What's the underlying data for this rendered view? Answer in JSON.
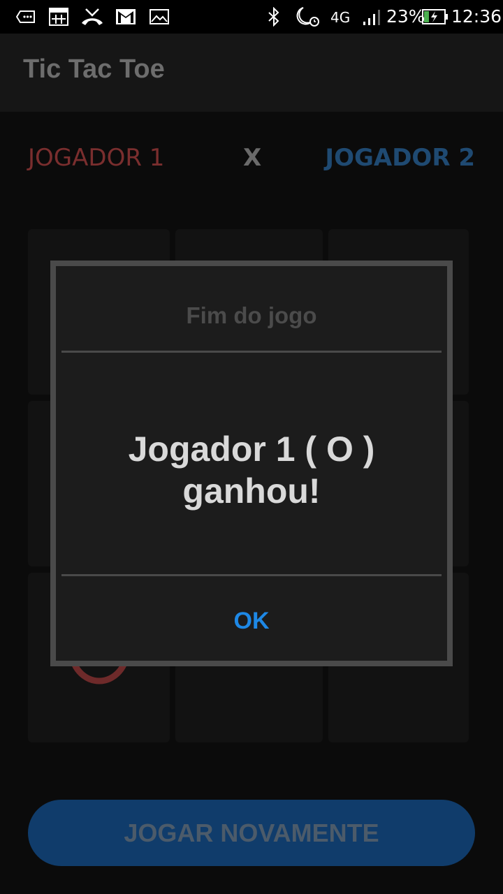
{
  "status_bar": {
    "network": "4G",
    "battery_percent": "23%",
    "time": "12:36",
    "icons": [
      "voicemail-icon",
      "calendar-icon",
      "missed-call-icon",
      "gmail-icon",
      "image-icon",
      "bluetooth-icon",
      "night-alarm-icon",
      "signal-icon",
      "battery-charging-icon"
    ]
  },
  "app": {
    "title": "Tic Tac Toe"
  },
  "score": {
    "player1": "JOGADOR 1",
    "separator": "X",
    "player2": "JOGADOR 2"
  },
  "board": {
    "cells": [
      "",
      "",
      "",
      "",
      "",
      "",
      "O",
      "",
      ""
    ]
  },
  "dialog": {
    "title": "Fim do jogo",
    "message_line1": "Jogador 1 ( O )",
    "message_line2": "ganhou!",
    "ok_label": "OK"
  },
  "actions": {
    "play_again_label": "JOGAR NOVAMENTE"
  },
  "colors": {
    "player1": "#7a2e2e",
    "player2": "#1f4a72",
    "accent": "#1e88e5"
  }
}
